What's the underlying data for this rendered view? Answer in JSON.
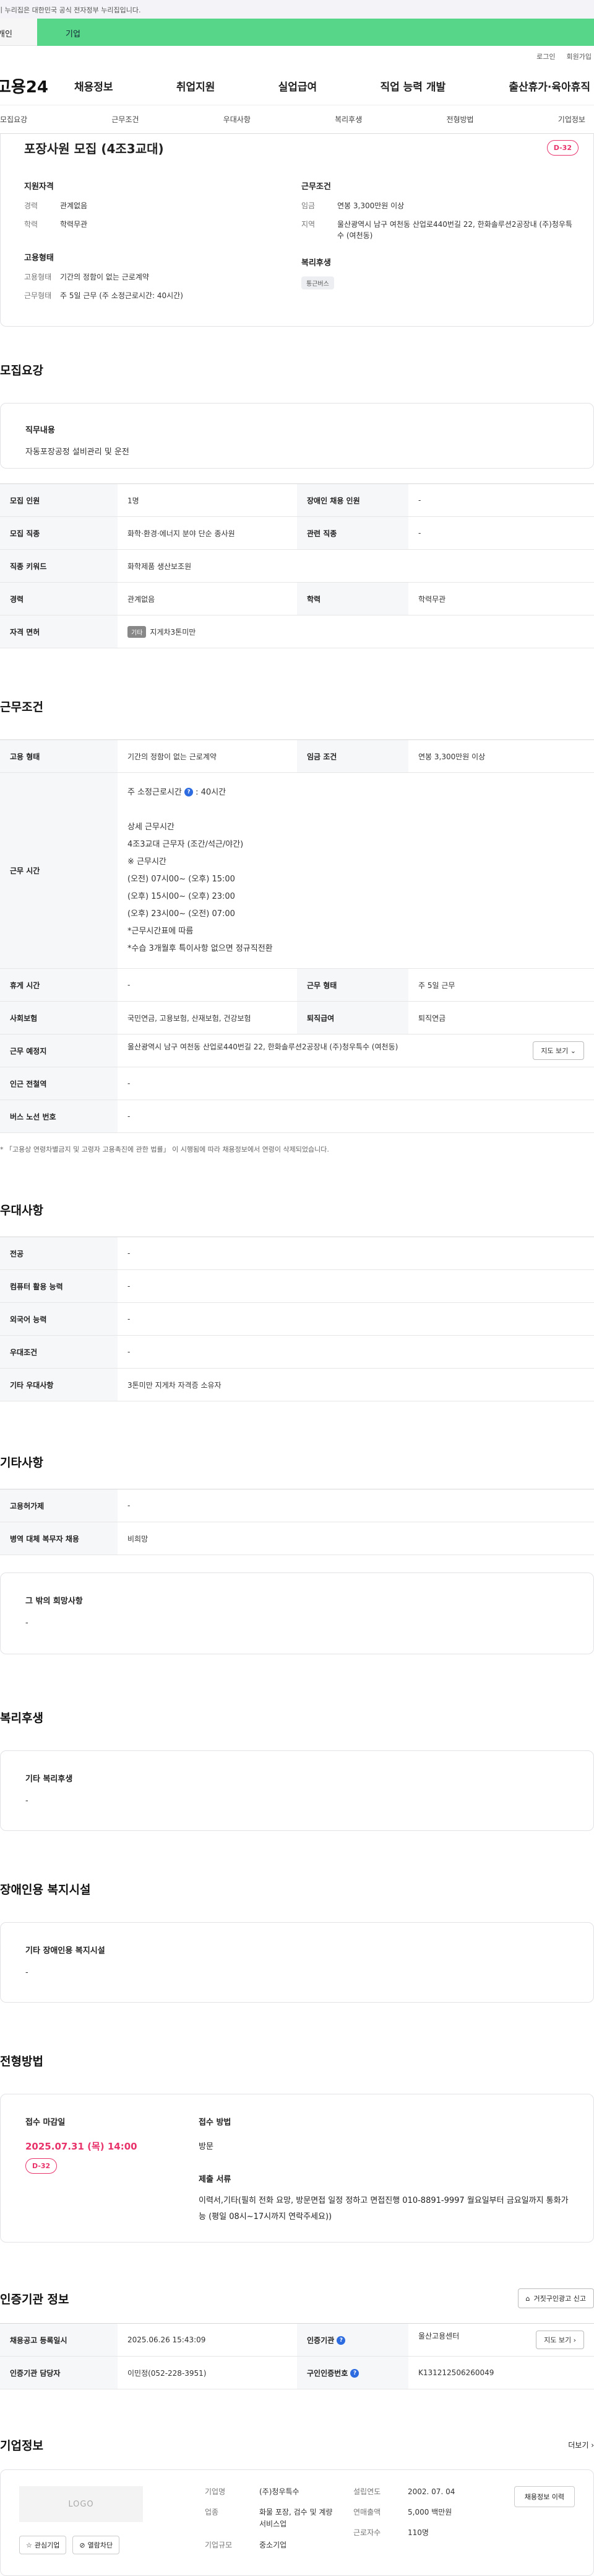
{
  "gov_banner": "이 누리집은 대한민국 공식 전자정부 누리집입니다.",
  "type_tabs": {
    "individual": "개인",
    "company": "기업"
  },
  "util": {
    "login": "로그인",
    "signup": "회원가입"
  },
  "gnb": {
    "logo": "고용24",
    "menu": [
      "채용정보",
      "취업지원",
      "실업급여",
      "직업 능력 개발",
      "출산휴가·육아휴직"
    ]
  },
  "tabs": [
    "모집요강",
    "근무조건",
    "우대사항",
    "복리후생",
    "전형방법",
    "기업정보"
  ],
  "post": {
    "title": "포장사원 모집 (4조3교대)",
    "dday": "D-32",
    "qual": {
      "title": "지원자격",
      "items": [
        {
          "k": "경력",
          "v": "관계없음"
        },
        {
          "k": "학력",
          "v": "학력무관"
        }
      ]
    },
    "emp": {
      "title": "고용형태",
      "items": [
        {
          "k": "고용형태",
          "v": "기간의 정함이 없는 근로계약"
        },
        {
          "k": "근무형태",
          "v": "주 5일 근무 (주 소정근로시간: 40시간)"
        }
      ]
    },
    "cond": {
      "title": "근무조건",
      "items": [
        {
          "k": "임금",
          "v": "연봉 3,300만원 이상"
        },
        {
          "k": "지역",
          "v": "울산광역시 남구 여천동 산업로440번길 22, 한화솔루션2공장내 (주)청우특수 (여천동)"
        }
      ]
    },
    "welfare": {
      "title": "복리후생",
      "chip": "통근버스"
    }
  },
  "recruit": {
    "title": "모집요강",
    "duty_title": "직무내용",
    "duty": "자동포장공정 설비관리 및 운전",
    "rows": {
      "count_k": "모집 인원",
      "count_v": "1명",
      "disabled_k": "장애인 채용 인원",
      "disabled_v": "-",
      "job_k": "모집 직종",
      "job_v": "화학·환경·에너지 분야 단순 종사원",
      "related_k": "관련 직종",
      "related_v": "-",
      "keyword_k": "직종 키워드",
      "keyword_v": "화학제품 생산보조원",
      "career_k": "경력",
      "career_v": "관계없음",
      "edu_k": "학력",
      "edu_v": "학력무관",
      "license_k": "자격 면허",
      "license_tag": "기타",
      "license_v": "지게차3톤미만"
    }
  },
  "work": {
    "title": "근무조건",
    "emp_k": "고용 형태",
    "emp_v": "기간의 정함이 없는 근로계약",
    "wage_k": "임금 조건",
    "wage_v": "연봉 3,300만원 이상",
    "hours_k": "근무 시간",
    "hours_main": "주 소정근로시간",
    "hours_main_val": ": 40시간",
    "hours_detail": [
      "상세 근무시간",
      "4조3교대 근무자 (조간/석근/야간)",
      "※ 근무시간",
      "(오전) 07시00~ (오후) 15:00",
      "(오후) 15시00~ (오후) 23:00",
      "(오후) 23시00~ (오전) 07:00",
      "*근무시간표에 따름",
      "*수습 3개월후 특이사항 없으면 정규직전환"
    ],
    "leave_k": "휴게 시간",
    "leave_v": "-",
    "form_k": "근무 형태",
    "form_v": "주 5일 근무",
    "ins_k": "사회보험",
    "ins_v": "국민연금, 고용보험, 산재보험, 건강보험",
    "ret_k": "퇴직급여",
    "ret_v": "퇴직연금",
    "place_k": "근무 예정지",
    "place_v": "울산광역시 남구 여천동 산업로440번길 22, 한화솔루션2공장내 (주)청우특수 (여천동)",
    "map_btn": "지도 보기",
    "subway_k": "인근 전철역",
    "subway_v": "-",
    "bus_k": "버스 노선 번호",
    "bus_v": "-",
    "note": "* 「고용상 연령차별금지 및 고령자 고용촉진에 관한 법률」 이 시행됨에 따라 채용정보에서 연령이 삭제되었습니다."
  },
  "pref": {
    "title": "우대사항",
    "rows": [
      {
        "k": "전공",
        "v": "-"
      },
      {
        "k": "컴퓨터 활용 능력",
        "v": "-"
      },
      {
        "k": "외국어 능력",
        "v": "-"
      },
      {
        "k": "우대조건",
        "v": "-"
      },
      {
        "k": "기타 우대사항",
        "v": "3톤미만 지게차 자격증 소유자"
      }
    ]
  },
  "etc": {
    "title": "기타사항",
    "rows": [
      {
        "k": "고용허가제",
        "v": "-"
      },
      {
        "k": "병역 대체 복무자 채용",
        "v": "비희망"
      }
    ],
    "box_title": "그 밖의 희망사항",
    "box_v": "-"
  },
  "welfare": {
    "title": "복리후생",
    "box_title": "기타 복리후생",
    "box_v": "-"
  },
  "disab": {
    "title": "장애인용 복지시설",
    "box_title": "기타 장애인용 복지시설",
    "box_v": "-"
  },
  "screen": {
    "title": "전형방법",
    "deadline_label": "접수 마감일",
    "deadline": "2025.07.31 (목) 14:00",
    "dday": "D-32",
    "method_label": "접수 방법",
    "method": "방문",
    "docs_label": "제출 서류",
    "docs": "이력서,기타(필히 전화 요망, 방문면접 일정 정하고 면접진행 010-8891-9997 월요일부터 금요일까지 통화가능 (평일 08시~17시까지 연락주세요))"
  },
  "agency": {
    "title": "인증기관 정보",
    "report_btn": "거짓구인광고 신고",
    "reg_k": "채용공고 등록일시",
    "reg_v": "2025.06.26 15:43:09",
    "org_k": "인증기관",
    "org_v": "울산고용센터",
    "map_btn": "지도 보기",
    "mgr_k": "인증기관 담당자",
    "mgr_v": "이민정(052-228-3951)",
    "id_k": "구인인증번호",
    "id_v": "K131212506260049"
  },
  "company": {
    "title": "기업정보",
    "more": "더보기",
    "logo": "LOGO",
    "interest_btn": "관심기업",
    "block_btn": "열람차단",
    "name_k": "기업명",
    "name_v": "(주)청우특수",
    "biz_k": "업종",
    "biz_v": "화물 포장, 검수 및 계량 서비스업",
    "size_k": "기업규모",
    "size_v": "중소기업",
    "year_k": "설립연도",
    "year_v": "2002. 07. 04",
    "sales_k": "연매출액",
    "sales_v": "5,000 백만원",
    "emp_k": "근로자수",
    "emp_v": "110명",
    "hist_btn": "채용정보 이력"
  },
  "colors": {
    "accent_green": "#57d68a",
    "dday_pink": "#e8336b",
    "info_blue": "#2d6be0"
  }
}
